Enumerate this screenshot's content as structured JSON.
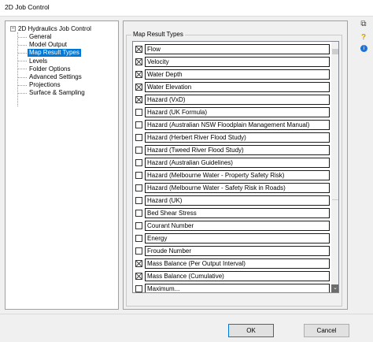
{
  "window": {
    "title": "2D Job Control"
  },
  "tree": {
    "root_label": "2D Hydraulics Job Control",
    "expander": "−",
    "items": [
      {
        "label": "General",
        "selected": false
      },
      {
        "label": "Model Output",
        "selected": false
      },
      {
        "label": "Map Result Types",
        "selected": true
      },
      {
        "label": "Levels",
        "selected": false
      },
      {
        "label": "Folder Options",
        "selected": false
      },
      {
        "label": "Advanced Settings",
        "selected": false
      },
      {
        "label": "Projections",
        "selected": false
      },
      {
        "label": "Surface & Sampling",
        "selected": false
      }
    ]
  },
  "group": {
    "title": "Map Result Types"
  },
  "result_types": [
    {
      "label": "Flow",
      "checked": true
    },
    {
      "label": "Velocity",
      "checked": true
    },
    {
      "label": "Water Depth",
      "checked": true
    },
    {
      "label": "Water Elevation",
      "checked": true
    },
    {
      "label": "Hazard (VxD)",
      "checked": true
    },
    {
      "label": "Hazard (UK Formula)",
      "checked": false
    },
    {
      "label": "Hazard (Australian NSW Floodplain Management Manual)",
      "checked": false
    },
    {
      "label": "Hazard (Herbert River Flood Study)",
      "checked": false
    },
    {
      "label": "Hazard (Tweed River Flood Study)",
      "checked": false
    },
    {
      "label": "Hazard (Australian Guidelines)",
      "checked": false
    },
    {
      "label": "Hazard (Melbourne Water - Property Safety Risk)",
      "checked": false
    },
    {
      "label": "Hazard (Melbourne Water - Safety Risk in Roads)",
      "checked": false
    },
    {
      "label": "Hazard (UK)",
      "checked": false
    },
    {
      "label": "Bed Shear Stress",
      "checked": false
    },
    {
      "label": "Courant Number",
      "checked": false
    },
    {
      "label": "Energy",
      "checked": false
    },
    {
      "label": "Froude Number",
      "checked": false
    },
    {
      "label": "Mass Balance (Per Output Interval)",
      "checked": true
    },
    {
      "label": "Mass Balance (Cumulative)",
      "checked": true
    },
    {
      "label": "Maximum...",
      "checked": false
    }
  ],
  "scrollbar": {
    "down_arrow": "⌄"
  },
  "icons": {
    "copy": "⧉",
    "help": "?",
    "info": "i"
  },
  "buttons": {
    "ok": "OK",
    "cancel": "Cancel"
  }
}
